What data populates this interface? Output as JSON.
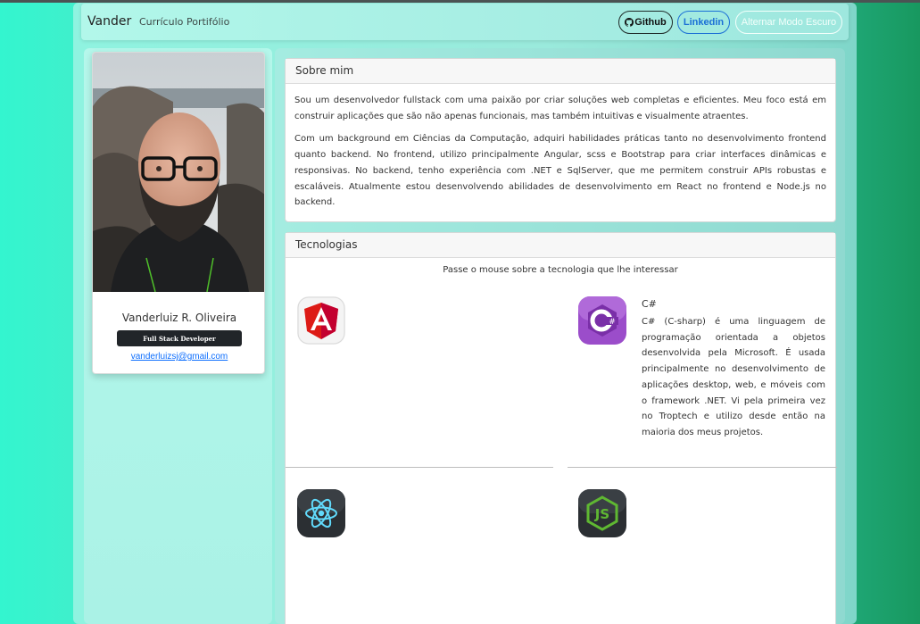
{
  "navbar": {
    "brand": "Vander",
    "links": [
      "Currículo",
      "Portifólio"
    ],
    "github_label": "Github",
    "linkedin_label": "Linkedin",
    "dark_mode_label": "Alternar Modo Escuro"
  },
  "profile": {
    "name": "Vanderluiz R. Oliveira",
    "role": "Full Stack Developer",
    "email": "vanderluizsj@gmail.com"
  },
  "about": {
    "title": "Sobre mim",
    "paragraphs": [
      "Sou um desenvolvedor fullstack com uma paixão por criar soluções web completas e eficientes. Meu foco está em construir aplicações que são não apenas funcionais, mas também intuitivas e visualmente atraentes.",
      "Com um background em Ciências da Computação, adquiri habilidades práticas tanto no desenvolvimento frontend quanto backend. No frontend, utilizo principalmente Angular, scss e Bootstrap para criar interfaces dinâmicas e responsivas. No backend, tenho experiência com .NET e SqlServer, que me permitem construir APIs robustas e escaláveis. Atualmente estou desenvolvendo abilidades de desenvolvimento em React no frontend e Node.js no backend."
    ]
  },
  "technologies": {
    "title": "Tecnologias",
    "hint": "Passe o mouse sobre a tecnologia que lhe interessar",
    "items": [
      {
        "icon": "angular-icon"
      },
      {
        "icon": "csharp-icon",
        "title": "C#",
        "description": "C# (C-sharp) é uma linguagem de programação orientada a objetos desenvolvida pela Microsoft. É usada principalmente no desenvolvimento de aplicações desktop, web, e móveis com o framework .NET. Vi pela primeira vez no Troptech e utilizo desde então na maioria dos meus projetos."
      },
      {
        "icon": "react-icon"
      },
      {
        "icon": "nodejs-icon"
      }
    ]
  },
  "colors": {
    "accent_teal": "#33f5cf",
    "link_blue": "#0d6efd",
    "linkedin_blue": "#1b6fd6",
    "badge_dark": "#212529"
  }
}
